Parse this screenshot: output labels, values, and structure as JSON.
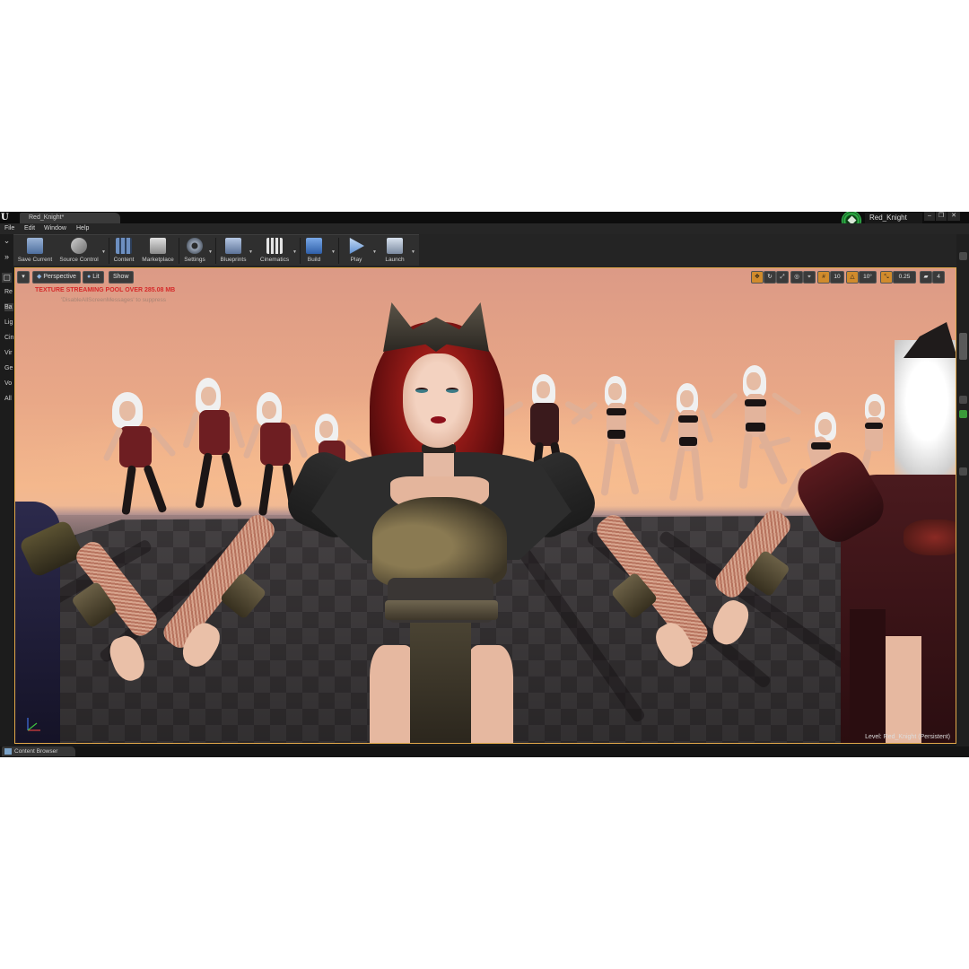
{
  "window": {
    "doc_tab": "Red_Knight*",
    "project_name": "Red_Knight",
    "controls": [
      "–",
      "❐",
      "✕"
    ]
  },
  "menu": [
    "File",
    "Edit",
    "Window",
    "Help"
  ],
  "toolbar": {
    "buttons": [
      {
        "label": "Save Current",
        "icon": "save-icon"
      },
      {
        "label": "Source Control",
        "icon": "source-control-icon"
      },
      {
        "label": "Content",
        "icon": "content-icon"
      },
      {
        "label": "Marketplace",
        "icon": "marketplace-icon"
      },
      {
        "label": "Settings",
        "icon": "settings-icon"
      },
      {
        "label": "Blueprints",
        "icon": "blueprints-icon"
      },
      {
        "label": "Cinematics",
        "icon": "cinematics-icon"
      },
      {
        "label": "Build",
        "icon": "build-icon"
      },
      {
        "label": "Play",
        "icon": "play-icon"
      },
      {
        "label": "Launch",
        "icon": "launch-icon"
      }
    ]
  },
  "left_panel": {
    "items": [
      "Re",
      "Ba",
      "Lig",
      "Cin",
      "Vir",
      "Ge",
      "Vo",
      "All"
    ]
  },
  "viewport": {
    "view_mode": "Perspective",
    "lighting": "Lit",
    "show": "Show",
    "warning": "TEXTURE STREAMING POOL OVER 285.08 MB",
    "suppress_hint": "'DisableAllScreenMessages' to suppress",
    "grid_snap": "10",
    "rotation_snap": "10°",
    "scale_snap": "0.25",
    "camera_speed": "4",
    "level_label": "Level: Red_Knight (Persistent)",
    "accent_color": "#e2a84a"
  },
  "bottom": {
    "content_browser_tab": "Content Browser"
  },
  "colors": {
    "warning_text": "#d62a2a",
    "project_badge": "#2fbf4a"
  }
}
